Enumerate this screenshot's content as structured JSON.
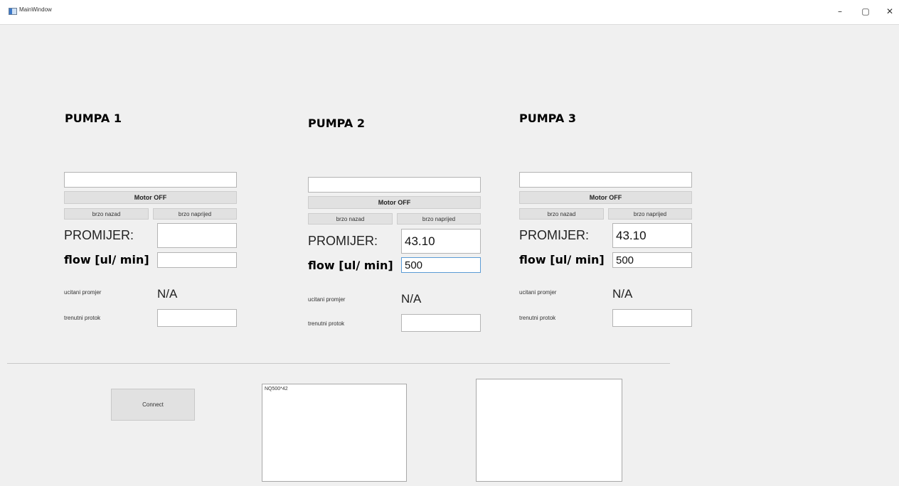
{
  "window": {
    "title": "MainWindow",
    "minimize_glyph": "–",
    "maximize_glyph": "▢",
    "close_glyph": "✕"
  },
  "pumps": [
    {
      "title": "PUMPA 1",
      "status_field": "",
      "motor_label": "Motor OFF",
      "back_label": "brzo nazad",
      "forward_label": "brzo naprijed",
      "diameter_label": "PROMIJER:",
      "diameter_value": "",
      "flow_label": "flow [ul/ min]",
      "flow_value": "",
      "loaded_diameter_label": "ucitani promjer",
      "loaded_diameter_value": "N/A",
      "current_flow_label": "trenutni protok",
      "current_flow_value": ""
    },
    {
      "title": "PUMPA 2",
      "status_field": "",
      "motor_label": "Motor OFF",
      "back_label": "brzo nazad",
      "forward_label": "brzo naprijed",
      "diameter_label": "PROMIJER:",
      "diameter_value": "43.10",
      "flow_label": "flow [ul/ min]",
      "flow_value": "500",
      "loaded_diameter_label": "ucitani promjer",
      "loaded_diameter_value": "N/A",
      "current_flow_label": "trenutni protok",
      "current_flow_value": ""
    },
    {
      "title": "PUMPA 3",
      "status_field": "",
      "motor_label": "Motor OFF",
      "back_label": "brzo nazad",
      "forward_label": "brzo naprijed",
      "diameter_label": "PROMIJER:",
      "diameter_value": "43.10",
      "flow_label": "flow [ul/ min]",
      "flow_value": "500",
      "loaded_diameter_label": "ucitani promjer",
      "loaded_diameter_value": "N/A",
      "current_flow_label": "trenutni protok",
      "current_flow_value": ""
    }
  ],
  "bottom": {
    "connect_label": "Connect",
    "log_text": "NQ500*42",
    "output_text": ""
  }
}
